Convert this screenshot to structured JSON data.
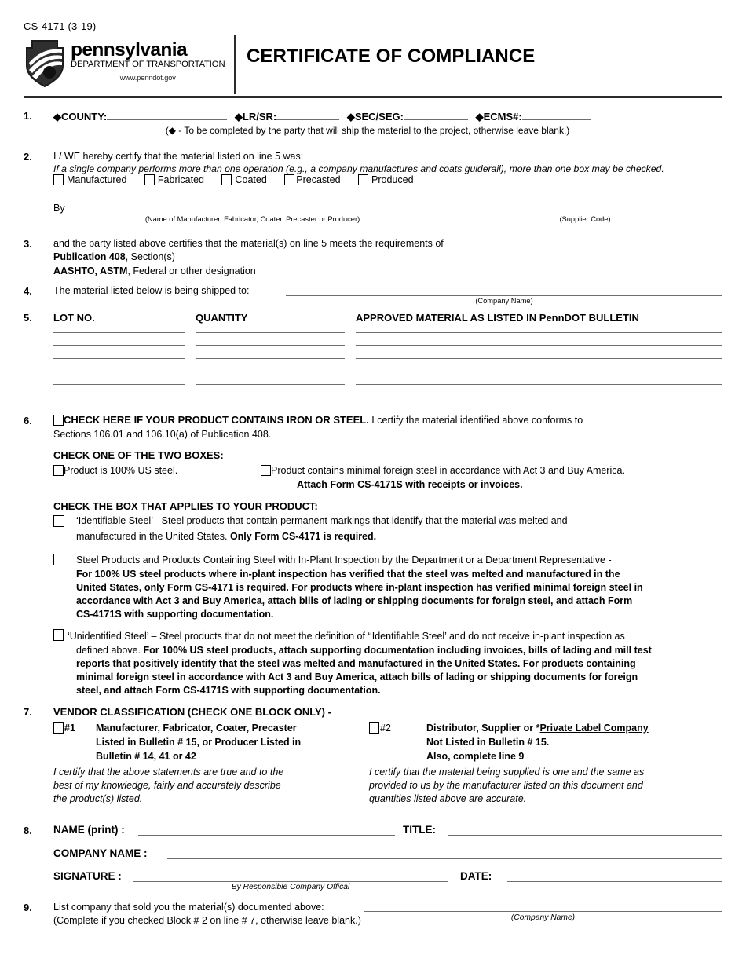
{
  "header": {
    "form_code": "CS-4171 (3-19)",
    "agency_name": "pennsylvania",
    "agency_dept": "DEPARTMENT OF TRANSPORTATION",
    "agency_url": "www.penndot.gov",
    "doc_title": "CERTIFICATE OF COMPLIANCE"
  },
  "line1": {
    "number": "1.",
    "county_label": "◆COUNTY:",
    "lrsr_label": "◆LR/SR:",
    "secseg_label": "◆SEC/SEG:",
    "ecms_label": "◆ECMS#:",
    "note": "(◆ - To be completed by the party that will ship the material to the project, otherwise leave blank.)"
  },
  "line2": {
    "number": "2.",
    "intro": "I / WE hereby certify that the material listed on line 5 was:",
    "italic_note": "If a single company performs more than one operation (e.g., a company manufactures and coats guiderail), more than one box may be checked.",
    "checkboxes": [
      {
        "label": "Manufactured",
        "checked": false
      },
      {
        "label": "Fabricated",
        "checked": false
      },
      {
        "label": "Coated",
        "checked": false
      },
      {
        "label": "Precasted",
        "checked": false
      },
      {
        "label": "Produced",
        "checked": false
      }
    ],
    "by_label": "By",
    "by_caption": "(Name of Manufacturer, Fabricator, Coater, Precaster or Producer)",
    "supplier_caption": "(Supplier Code)",
    "by_value": "",
    "supplier_value": ""
  },
  "line3": {
    "number": "3.",
    "intro": "and the party listed above certifies that the material(s) on line 5 meets the requirements of",
    "pub_bold": "Publication 408",
    "pub_rest": ", Section(s)",
    "std_bold": "AASHTO, ASTM",
    "std_rest": ", Federal or other designation",
    "pub_value": "",
    "std_value": ""
  },
  "line4": {
    "number": "4.",
    "text": "The material listed below is being shipped to:",
    "caption": "(Company Name)",
    "value": ""
  },
  "line5": {
    "number": "5.",
    "columns": [
      "LOT NO.",
      "QUANTITY",
      "APPROVED MATERIAL AS LISTED IN PennDOT BULLETIN"
    ],
    "rows": [
      {
        "lot": "",
        "quantity": "",
        "material": ""
      },
      {
        "lot": "",
        "quantity": "",
        "material": ""
      },
      {
        "lot": "",
        "quantity": "",
        "material": ""
      },
      {
        "lot": "",
        "quantity": "",
        "material": ""
      },
      {
        "lot": "",
        "quantity": "",
        "material": ""
      },
      {
        "lot": "",
        "quantity": "",
        "material": ""
      }
    ]
  },
  "line6": {
    "number": "6.",
    "iron_checked": false,
    "iron_bold": "CHECK HERE IF YOUR PRODUCT CONTAINS IRON OR STEEL.",
    "iron_rest": " I certify the material identified above conforms to",
    "iron_line2": "Sections 106.01 and 106.10(a) of Publication 408.",
    "check_two_heading": "CHECK ONE OF THE TWO BOXES:",
    "us_steel_label": "Product is 100% US steel.",
    "us_steel_checked": false,
    "foreign_label": "Product contains minimal foreign steel in accordance with Act 3 and Buy America.",
    "foreign_checked": false,
    "foreign_bold_line": "Attach Form CS-4171S with receipts or invoices.",
    "applies_heading": "CHECK THE BOX THAT APPLIES TO YOUR PRODUCT:",
    "option_identifiable": {
      "checked": false,
      "part1": "‘Identifiable Steel’ - Steel products that contain permanent markings that identify that the material was melted and",
      "part2_normal": "manufactured in the United States. ",
      "part2_bold": "Only Form CS-4171 is required."
    },
    "option_inplant": {
      "checked": false,
      "lead": "Steel Products and Products Containing Steel with In-Plant Inspection by the Department or a Department Representative -",
      "bold_lines": [
        "For 100% US steel products where in-plant inspection has verified that the steel was melted and manufactured in the",
        "United States, only Form CS-4171 is required. For products where in-plant inspection has verified minimal foreign steel in",
        "accordance with Act 3 and Buy America, attach bills of lading or shipping documents for foreign steel, and attach Form",
        "CS-4171S with supporting documentation."
      ]
    },
    "option_unidentified": {
      "checked": false,
      "lead": "‘Unidentified Steel’ – Steel products that do not meet the definition of ‘‘Identifiable Steel’ and do not receive in-plant inspection as",
      "line2_normal": "defined above. ",
      "line2_bold": "For 100% US steel products, attach supporting documentation including invoices, bills of lading and mill test",
      "bold_lines": [
        "reports that positively identify that the steel was melted and manufactured in the United States. For products containing",
        "minimal foreign steel in accordance with Act 3 and Buy America, attach bills of lading or shipping documents for foreign",
        "steel, and attach Form CS-4171S with supporting documentation."
      ]
    }
  },
  "line7": {
    "number": "7.",
    "heading": "VENDOR CLASSIFICATION (CHECK ONE BLOCK ONLY) -",
    "block1": {
      "checked": false,
      "tag": "#1",
      "lines": [
        "Manufacturer,  Fabricator,  Coater,  Precaster",
        "Listed in Bulletin # 15, or Producer Listed in",
        "Bulletin # 14, 41 or 42"
      ],
      "certify": [
        "I certify that the above statements are true and to the",
        "best of my knowledge, fairly and accurately describe",
        "the product(s) listed."
      ]
    },
    "block2": {
      "checked": false,
      "tag": "#2",
      "lines_prefix": "Distributor,  Supplier  or  *",
      "lines_underlined": "Private Label Company",
      "line2": "Not Listed in Bulletin # 15.",
      "line3": "Also, complete line 9",
      "certify": [
        "I certify that the material being supplied is one and the same as",
        "provided to us by the manufacturer listed on this document and",
        "quantities listed above are accurate."
      ]
    }
  },
  "line8": {
    "number": "8.",
    "name_label": "NAME (print) :",
    "name_value": "",
    "title_label": "TITLE:",
    "title_value": "",
    "company_label": "COMPANY NAME :",
    "company_value": "",
    "signature_label": "SIGNATURE :",
    "signature_value": "",
    "signature_caption": "By Responsible Company Offical",
    "date_label": "DATE:",
    "date_value": ""
  },
  "line9": {
    "number": "9.",
    "text": "List company that sold you the material(s) documented above:",
    "note": "(Complete if you checked Block # 2 on line # 7, otherwise leave blank.)",
    "caption": "(Company Name)",
    "value": ""
  }
}
